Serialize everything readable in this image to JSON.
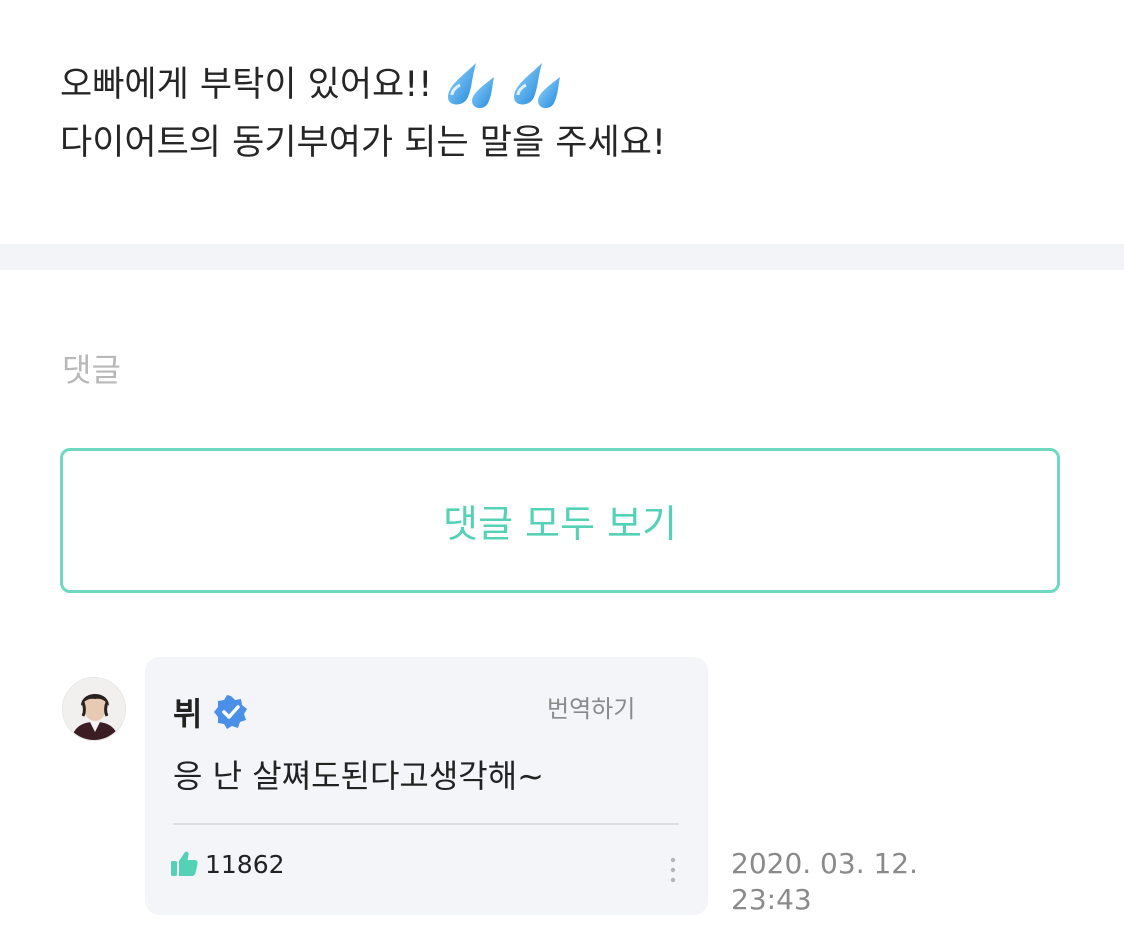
{
  "post": {
    "line1": "오빠에게 부탁이 있어요!!",
    "line2": "다이어트의 동기부여가 되는 말을 주세요!",
    "emoji_icons": [
      "sweat-droplets-icon",
      "sweat-droplets-icon"
    ]
  },
  "comments_section": {
    "heading": "댓글",
    "view_all_label": "댓글 모두 보기"
  },
  "comment": {
    "author": "뷔",
    "verified": true,
    "translate_label": "번역하기",
    "text": "응 난 살쪄도된다고생각해~",
    "likes": "11862",
    "date": "2020. 03. 12.",
    "time": "23:43"
  },
  "colors": {
    "accent": "#55d2b6",
    "verified_blue": "#4a90e8",
    "card_bg": "#f4f5f9",
    "divider_bg": "#f3f4f8"
  }
}
